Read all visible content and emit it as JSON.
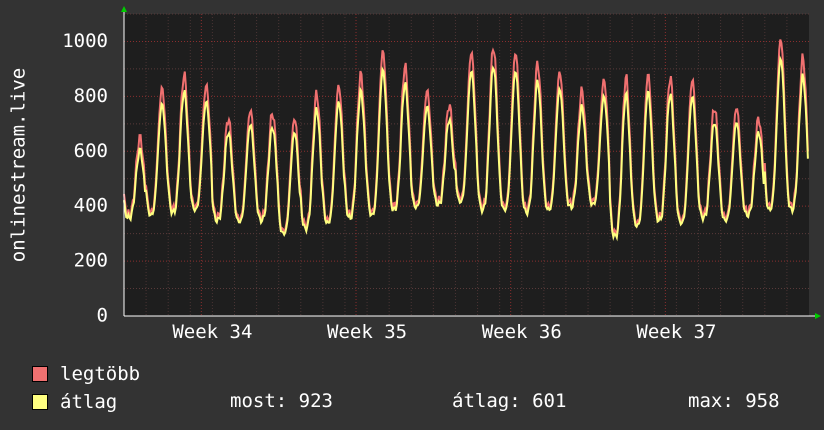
{
  "colors": {
    "background": "#333333",
    "plot": "#1e1e1e",
    "max_line": "#f07070",
    "avg_line": "#ffff80"
  },
  "legend": [
    {
      "label": "legtöbb",
      "color": "#f07070"
    },
    {
      "label": "átlag",
      "color": "#ffff80"
    }
  ],
  "stats": {
    "current": "most: 923",
    "average": "átlag: 601",
    "maximum": "max: 958"
  },
  "chart_data": {
    "type": "line",
    "title": "",
    "xlabel": "",
    "ylabel": "onlinestream.live",
    "ylim": [
      0,
      1100
    ],
    "xlim": [
      0,
      31
    ],
    "grid": true,
    "yticks": [
      0,
      200,
      400,
      600,
      800,
      1000
    ],
    "x_ticks": [
      {
        "x": 4.0,
        "label": "Week 34"
      },
      {
        "x": 11.0,
        "label": "Week 35"
      },
      {
        "x": 18.0,
        "label": "Week 36"
      },
      {
        "x": 25.0,
        "label": "Week 37"
      }
    ],
    "days": [
      {
        "day": 0,
        "min": 370,
        "max": 650
      },
      {
        "day": 1,
        "min": 380,
        "max": 830
      },
      {
        "day": 2,
        "min": 390,
        "max": 880
      },
      {
        "day": 3,
        "min": 400,
        "max": 840
      },
      {
        "day": 4,
        "min": 360,
        "max": 720
      },
      {
        "day": 5,
        "min": 355,
        "max": 750
      },
      {
        "day": 6,
        "min": 360,
        "max": 740
      },
      {
        "day": 7,
        "min": 310,
        "max": 720
      },
      {
        "day": 8,
        "min": 330,
        "max": 810
      },
      {
        "day": 9,
        "min": 350,
        "max": 840
      },
      {
        "day": 10,
        "min": 370,
        "max": 880
      },
      {
        "day": 11,
        "min": 380,
        "max": 965
      },
      {
        "day": 12,
        "min": 400,
        "max": 910
      },
      {
        "day": 13,
        "min": 410,
        "max": 820
      },
      {
        "day": 14,
        "min": 420,
        "max": 770
      },
      {
        "day": 15,
        "min": 430,
        "max": 960
      },
      {
        "day": 16,
        "min": 400,
        "max": 980
      },
      {
        "day": 17,
        "min": 400,
        "max": 960
      },
      {
        "day": 18,
        "min": 390,
        "max": 920
      },
      {
        "day": 19,
        "min": 400,
        "max": 890
      },
      {
        "day": 20,
        "min": 410,
        "max": 820
      },
      {
        "day": 21,
        "min": 420,
        "max": 860
      },
      {
        "day": 22,
        "min": 300,
        "max": 870
      },
      {
        "day": 23,
        "min": 340,
        "max": 880
      },
      {
        "day": 24,
        "min": 360,
        "max": 870
      },
      {
        "day": 25,
        "min": 350,
        "max": 860
      },
      {
        "day": 26,
        "min": 370,
        "max": 760
      },
      {
        "day": 27,
        "min": 360,
        "max": 760
      },
      {
        "day": 28,
        "min": 380,
        "max": 720
      },
      {
        "day": 29,
        "min": 400,
        "max": 1010
      },
      {
        "day": 30,
        "min": 400,
        "max": 940
      }
    ],
    "series": [
      {
        "name": "legtöbb",
        "color": "#f07070"
      },
      {
        "name": "átlag",
        "color": "#ffff80",
        "ratio": 0.93
      }
    ]
  }
}
